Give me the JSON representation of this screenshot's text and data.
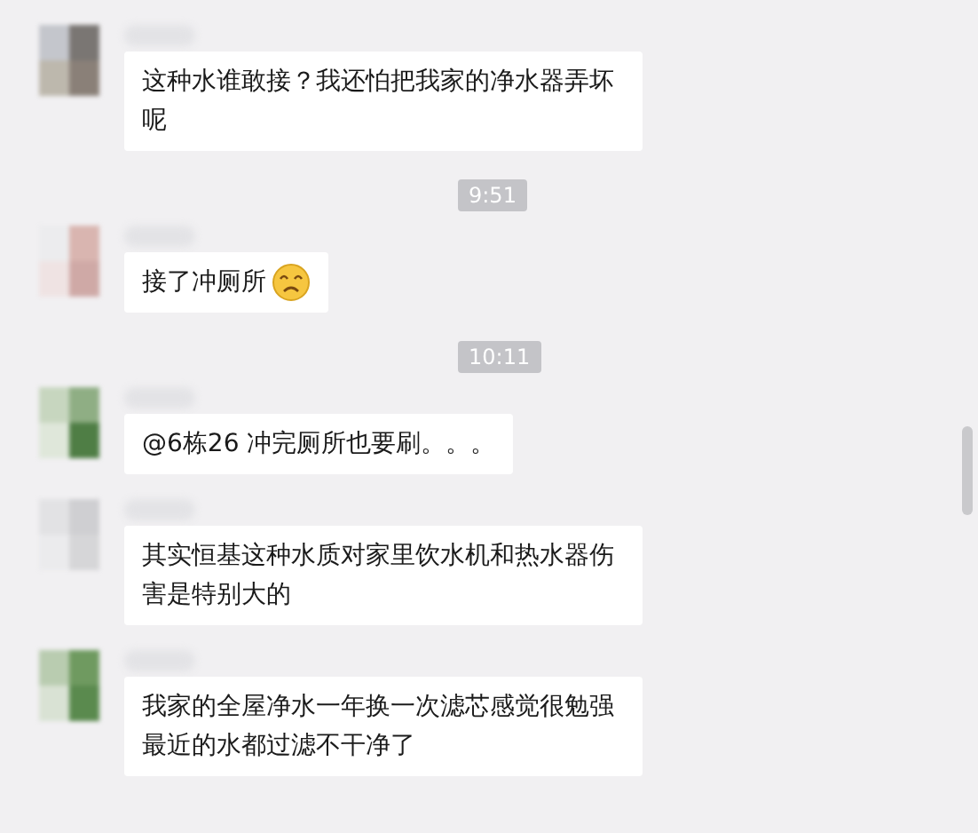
{
  "messages": [
    {
      "kind": "message",
      "text": "这种水谁敢接？我还怕把我家的净水器弄坏呢",
      "emoji": false
    },
    {
      "kind": "time",
      "text": "9:51"
    },
    {
      "kind": "message",
      "text": "接了冲厕所",
      "emoji": true
    },
    {
      "kind": "time",
      "text": "10:11"
    },
    {
      "kind": "message",
      "text": "@6栋26 冲完厕所也要刷。。。",
      "emoji": false
    },
    {
      "kind": "message",
      "text": "其实恒基这种水质对家里饮水机和热水器伤害是特别大的",
      "emoji": false
    },
    {
      "kind": "message",
      "text": "我家的全屋净水一年换一次滤芯感觉很勉强最近的水都过滤不干净了",
      "emoji": false
    }
  ]
}
